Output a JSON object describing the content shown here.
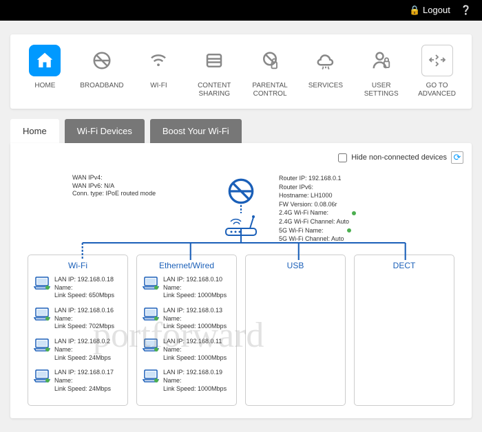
{
  "topbar": {
    "logout": "Logout"
  },
  "nav": [
    {
      "label": "HOME",
      "active": true
    },
    {
      "label": "BROADBAND"
    },
    {
      "label": "WI-FI"
    },
    {
      "label": "CONTENT\nSHARING"
    },
    {
      "label": "PARENTAL\nCONTROL"
    },
    {
      "label": "SERVICES"
    },
    {
      "label": "USER\nSETTINGS"
    },
    {
      "label": "GO TO\nADVANCED"
    }
  ],
  "tabs": [
    {
      "label": "Home",
      "active": true
    },
    {
      "label": "Wi-Fi Devices"
    },
    {
      "label": "Boost Your Wi-Fi"
    }
  ],
  "hideNonConnected": "Hide non-connected devices",
  "wan": {
    "ipv4": "WAN IPv4:",
    "ipv6": "WAN IPv6: N/A",
    "conn": "Conn. type: IPoE routed mode"
  },
  "router": {
    "ip": "Router IP: 192.168.0.1",
    "ipv6": "Router IPv6:",
    "host": "Hostname: LH1000",
    "fw": "FW Version: 0.08.06r",
    "w24name": "2.4G Wi-Fi Name:",
    "w24ch": "2.4G Wi-Fi Channel: Auto",
    "w5name": "5G Wi-Fi Name:",
    "w5ch": "5G Wi-Fi Channel: Auto"
  },
  "branches": {
    "wifi": {
      "title": "Wi-Fi",
      "devices": [
        {
          "ip": "LAN IP: 192.168.0.18",
          "name": "Name:",
          "spd": "Link Speed: 650Mbps"
        },
        {
          "ip": "LAN IP: 192.168.0.16",
          "name": "Name:",
          "spd": "Link Speed: 702Mbps"
        },
        {
          "ip": "LAN IP: 192.168.0.2",
          "name": "Name:",
          "spd": "Link Speed: 24Mbps"
        },
        {
          "ip": "LAN IP: 192.168.0.17",
          "name": "Name:",
          "spd": "Link Speed: 24Mbps"
        }
      ]
    },
    "eth": {
      "title": "Ethernet/Wired",
      "devices": [
        {
          "ip": "LAN IP: 192.168.0.10",
          "name": "Name:",
          "spd": "Link Speed: 1000Mbps"
        },
        {
          "ip": "LAN IP: 192.168.0.13",
          "name": "Name:",
          "spd": "Link Speed: 1000Mbps"
        },
        {
          "ip": "LAN IP: 192.168.0.11",
          "name": "Name:",
          "spd": "Link Speed: 1000Mbps"
        },
        {
          "ip": "LAN IP: 192.168.0.19",
          "name": "Name:",
          "spd": "Link Speed: 1000Mbps"
        }
      ]
    },
    "usb": {
      "title": "USB"
    },
    "dect": {
      "title": "DECT"
    }
  },
  "watermark": "portforward"
}
